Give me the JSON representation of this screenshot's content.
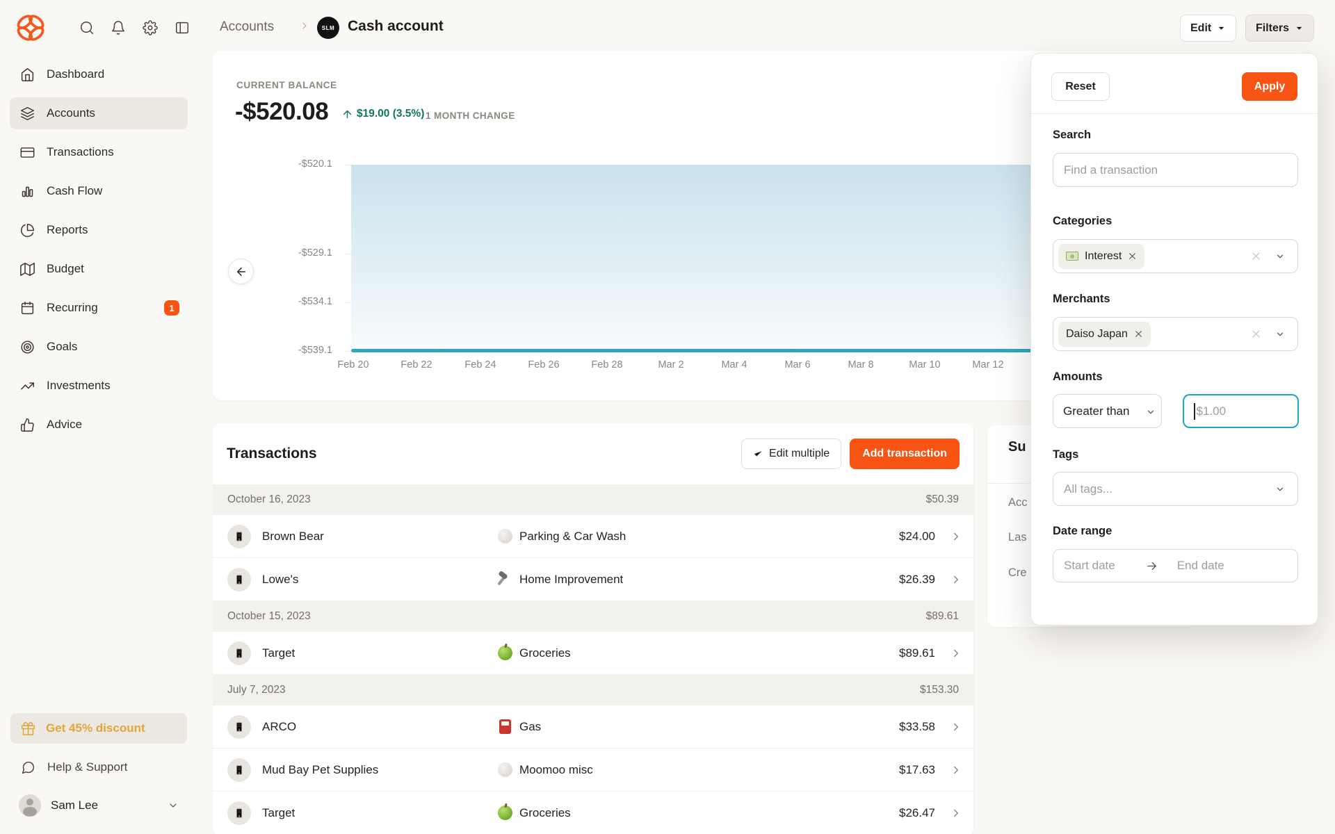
{
  "header": {
    "breadcrumb_root": "Accounts",
    "account_avatar_text": "SLM",
    "page_title": "Cash account",
    "edit_button": "Edit",
    "filters_button": "Filters"
  },
  "sidebar": {
    "items": [
      {
        "label": "Dashboard"
      },
      {
        "label": "Accounts"
      },
      {
        "label": "Transactions"
      },
      {
        "label": "Cash Flow"
      },
      {
        "label": "Reports"
      },
      {
        "label": "Budget"
      },
      {
        "label": "Recurring",
        "badge": "1"
      },
      {
        "label": "Goals"
      },
      {
        "label": "Investments"
      },
      {
        "label": "Advice"
      }
    ],
    "promo_label": "Get 45% discount",
    "help_label": "Help & Support",
    "user_name": "Sam Lee"
  },
  "balance_card": {
    "label": "CURRENT BALANCE",
    "balance": "-$520.08",
    "change": "$19.00 (3.5%)",
    "change_period": "1 MONTH CHANGE"
  },
  "chart_data": {
    "type": "area",
    "title": "Cash account balance, 1 month",
    "x_ticks": [
      "Feb 20",
      "Feb 22",
      "Feb 24",
      "Feb 26",
      "Feb 28",
      "Mar 2",
      "Mar 4",
      "Mar 6",
      "Mar 8",
      "Mar 10",
      "Mar 12"
    ],
    "y_ticks": [
      "-$520.1",
      "-$529.1",
      "-$534.1",
      "-$539.1"
    ],
    "y_tick_offsets_pct": [
      0,
      47.8,
      73.9,
      100
    ],
    "series": [
      {
        "name": "Balance",
        "x": [
          "Feb 20",
          "Feb 22",
          "Feb 24",
          "Feb 26",
          "Feb 28",
          "Mar 2",
          "Mar 4",
          "Mar 6",
          "Mar 8",
          "Mar 10",
          "Mar 12"
        ],
        "values": [
          -539.1,
          -539.1,
          -539.1,
          -539.1,
          -539.1,
          -539.1,
          -539.1,
          -539.1,
          -539.1,
          -539.1,
          -539.1
        ],
        "note": "flat teal line at bottom gridline with light-blue area fill above"
      }
    ],
    "line_color": "#2BA8BF",
    "fill_top_color": "#C9E2ED",
    "fill_bottom_color": "#F8FBFC",
    "grid": true,
    "legend": false
  },
  "transactions": {
    "title": "Transactions",
    "edit_multiple_button": "Edit multiple",
    "add_button": "Add transaction",
    "groups": [
      {
        "date": "October 16, 2023",
        "total": "$50.39",
        "rows": [
          {
            "merchant": "Brown Bear",
            "category": "Parking & Car Wash",
            "icon": "gray-circle",
            "amount": "$24.00"
          },
          {
            "merchant": "Lowe's",
            "category": "Home Improvement",
            "icon": "hammer",
            "amount": "$26.39"
          }
        ]
      },
      {
        "date": "October 15, 2023",
        "total": "$89.61",
        "rows": [
          {
            "merchant": "Target",
            "category": "Groceries",
            "icon": "green-apple",
            "amount": "$89.61"
          }
        ]
      },
      {
        "date": "July 7, 2023",
        "total": "$153.30",
        "rows": [
          {
            "merchant": "ARCO",
            "category": "Gas",
            "icon": "fuel-pump",
            "amount": "$33.58"
          },
          {
            "merchant": "Mud Bay Pet Supplies",
            "category": "Moomoo misc",
            "icon": "gray-circle",
            "amount": "$17.63"
          },
          {
            "merchant": "Target",
            "category": "Groceries",
            "icon": "green-apple",
            "amount": "$26.47"
          }
        ]
      }
    ]
  },
  "summary_sliver": {
    "title_fragment": "Su",
    "row_fragments": [
      "Acc",
      "Las",
      "Cre"
    ]
  },
  "filters": {
    "reset_button": "Reset",
    "apply_button": "Apply",
    "search_label": "Search",
    "search_placeholder": "Find a transaction",
    "categories_label": "Categories",
    "category_chip": "Interest",
    "merchants_label": "Merchants",
    "merchant_chip": "Daiso Japan",
    "amounts_label": "Amounts",
    "amount_operator": "Greater than",
    "amount_value_placeholder": "$1.00",
    "tags_label": "Tags",
    "tags_value": "All tags...",
    "date_range_label": "Date range",
    "start_placeholder": "Start date",
    "end_placeholder": "End date"
  },
  "colors": {
    "accent_orange": "#F75414",
    "positive_green": "#0E7B4E",
    "chart_teal": "#2BA8BF",
    "focus_teal": "#1BA6C6",
    "promo_amber": "#E3A53A"
  }
}
